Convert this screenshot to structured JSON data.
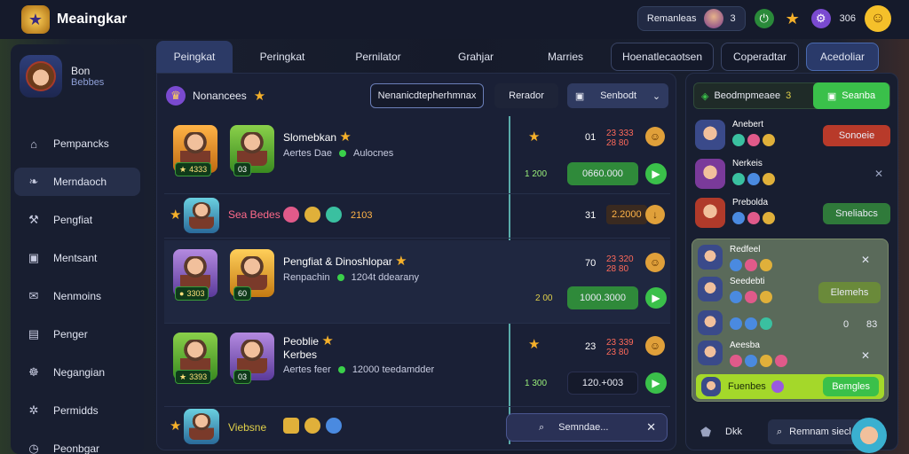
{
  "app": {
    "title": "Meaingkar"
  },
  "topbar": {
    "profile_pill": {
      "label": "Remanleas",
      "count": "3"
    },
    "coins": "306"
  },
  "profile": {
    "name": "Bon",
    "subtitle": "Bebbes"
  },
  "sidebar": {
    "items": [
      {
        "label": "Pempancks",
        "icon": "castle-icon"
      },
      {
        "label": "Merndaoch",
        "icon": "leaf-icon"
      },
      {
        "label": "Pengfiat",
        "icon": "hammer-icon"
      },
      {
        "label": "Mentsant",
        "icon": "square-icon"
      },
      {
        "label": "Nenmoins",
        "icon": "chat-icon"
      },
      {
        "label": "Penger",
        "icon": "document-icon"
      },
      {
        "label": "Negangian",
        "icon": "users-icon"
      },
      {
        "label": "Permidds",
        "icon": "gear-icon"
      },
      {
        "label": "Peonbgar",
        "icon": "clock-icon"
      }
    ]
  },
  "tabs": [
    {
      "label": "Peingkat"
    },
    {
      "label": "Peringkat"
    },
    {
      "label": "Pernilator"
    },
    {
      "label": "Grahjar"
    },
    {
      "label": "Marries"
    },
    {
      "label": "Hoenatlecaotsen"
    },
    {
      "label": "Coperadtar"
    },
    {
      "label": "Acedoliar"
    }
  ],
  "panel": {
    "title": "Nonancees",
    "search": "Nenanicdtepherhmnax",
    "btn1": "Rerador",
    "btn2": "Senbodt",
    "rows": [
      {
        "name": "Slomebkan",
        "sub": "Aertes Dae",
        "sub2": "Aulocnes",
        "lvl": "4333",
        "lvl2": "03",
        "rank": "01",
        "redv": "23 333\n28 80",
        "greenv": "1 200",
        "bar": "0660.000"
      },
      {
        "name": "Sea Bedes",
        "score": "2103",
        "rank": "31",
        "bar": "2.2000"
      },
      {
        "name": "Pengfiat & Dinoshlopar",
        "sub": "Renpachin",
        "sub2": "1204t ddearany",
        "lvl": "3303",
        "lvl2": "60",
        "rank": "70",
        "redv": "23 320\n28 80",
        "greenv": "2 00",
        "bar": "1000.3000"
      },
      {
        "name": "Peoblie",
        "name2": "Kerbes",
        "sub": "Aertes feer",
        "sub2": "12000 teedamdder",
        "lvl": "3393",
        "lvl2": "03",
        "rank": "23",
        "redv": "23 339\n23 80",
        "greenv": "1 300",
        "bar": "120.+003"
      },
      {
        "name": "Viebsne"
      }
    ],
    "bottom_search": "Semndae..."
  },
  "right": {
    "top_label": "Beodmpmeaee",
    "top_count": "3",
    "top_btn": "Seanba",
    "rows": [
      {
        "name": "Anebert",
        "btn": "Sonoeie"
      },
      {
        "name": "Nerkeis"
      },
      {
        "name": "Prebolda",
        "btn": "Sneliabcs"
      }
    ],
    "sub_rows": [
      {
        "name": "Redfeel"
      },
      {
        "name": "Seedebti",
        "btn": "Elemehs"
      },
      {
        "name": "",
        "val1": "0",
        "val2": "83"
      },
      {
        "name": "Aeesba"
      }
    ],
    "sub_footer_label": "Fuenbes",
    "sub_footer_btn": "Bemgles",
    "bottom_label": "Dkk",
    "bottom_btn": "Remnam siecl"
  },
  "colors": {
    "accent": "#3ac04a",
    "gold": "#f5b02a",
    "bg": "#151a2a"
  }
}
